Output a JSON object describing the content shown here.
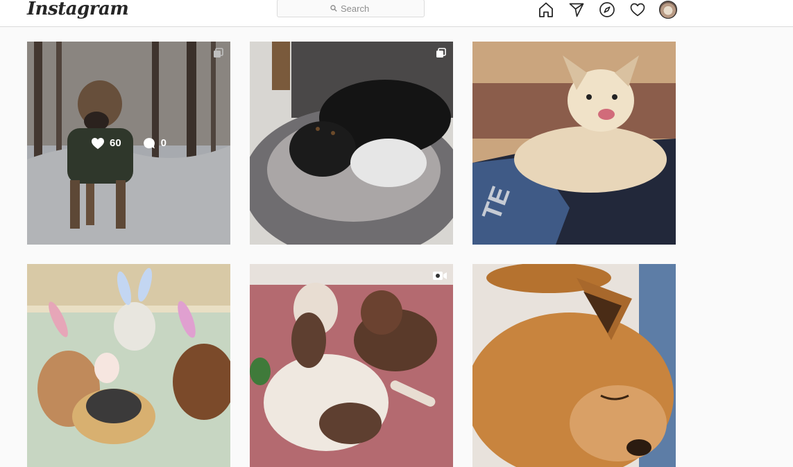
{
  "header": {
    "logo_text": "Instagram",
    "search": {
      "placeholder": "Search",
      "icon": "search-icon"
    },
    "nav_icons": [
      "home-icon",
      "direct-icon",
      "explore-icon",
      "activity-icon",
      "profile-avatar"
    ]
  },
  "posts": [
    {
      "subject": "brindle dog in green sweater standing in snowy woods",
      "badge": "carousel-icon",
      "hover": true,
      "likes": "60",
      "comments": "0"
    },
    {
      "subject": "black dog sleeping in grey round bed",
      "badge": "carousel-icon"
    },
    {
      "subject": "small fluffy cream dog on blue sweatshirt",
      "badge": ""
    },
    {
      "subject": "three boxer dogs with Easter bunny ears and basket",
      "badge": ""
    },
    {
      "subject": "two poodles lying on pink carpet",
      "badge": "video-icon"
    },
    {
      "subject": "ginger dog sleeping curled up",
      "badge": ""
    }
  ],
  "colors": {
    "background": "#fafafa",
    "header_bg": "#ffffff",
    "border": "#dbdbdb",
    "text": "#262626",
    "placeholder": "#8e8e8e"
  }
}
